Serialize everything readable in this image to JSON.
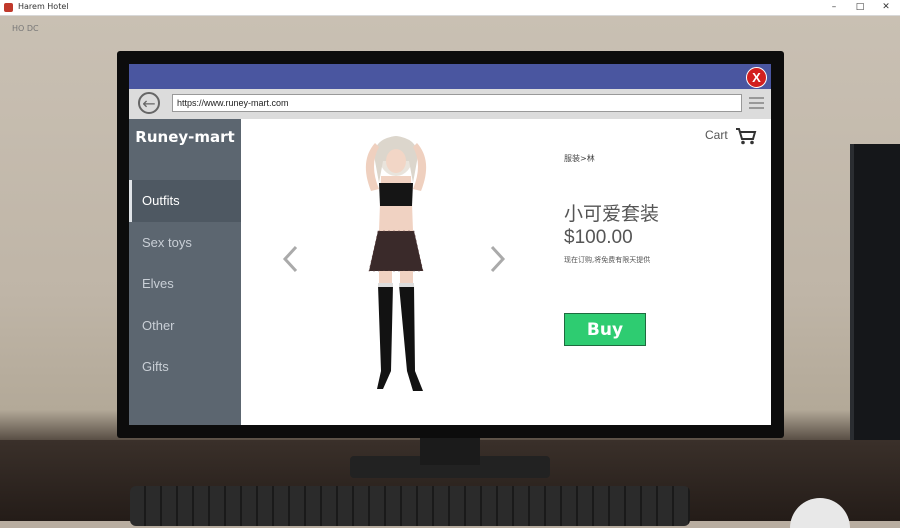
{
  "window": {
    "title": "Harem Hotel",
    "controls": [
      "–",
      "□",
      "✕"
    ]
  },
  "wall_text": "HO DC",
  "browser": {
    "close_label": "X",
    "url": "https://www.runey-mart.com"
  },
  "sidebar": {
    "brand": "Runey-mart",
    "items": [
      {
        "label": "Outfits",
        "active": true
      },
      {
        "label": "Sex toys",
        "active": false
      },
      {
        "label": "Elves",
        "active": false
      },
      {
        "label": "Other",
        "active": false
      },
      {
        "label": "Gifts",
        "active": false
      }
    ]
  },
  "product": {
    "cart_label": "Cart",
    "breadcrumb": "服装>林",
    "name": "小可爱套装",
    "price": "$100.00",
    "description": "现在订购,将免费有限天提供",
    "buy_label": "Buy"
  },
  "colors": {
    "header": "#4a56a0",
    "sidebar": "#5c6670",
    "buy_button": "#2ecc71",
    "close_button": "#d21f1f"
  }
}
